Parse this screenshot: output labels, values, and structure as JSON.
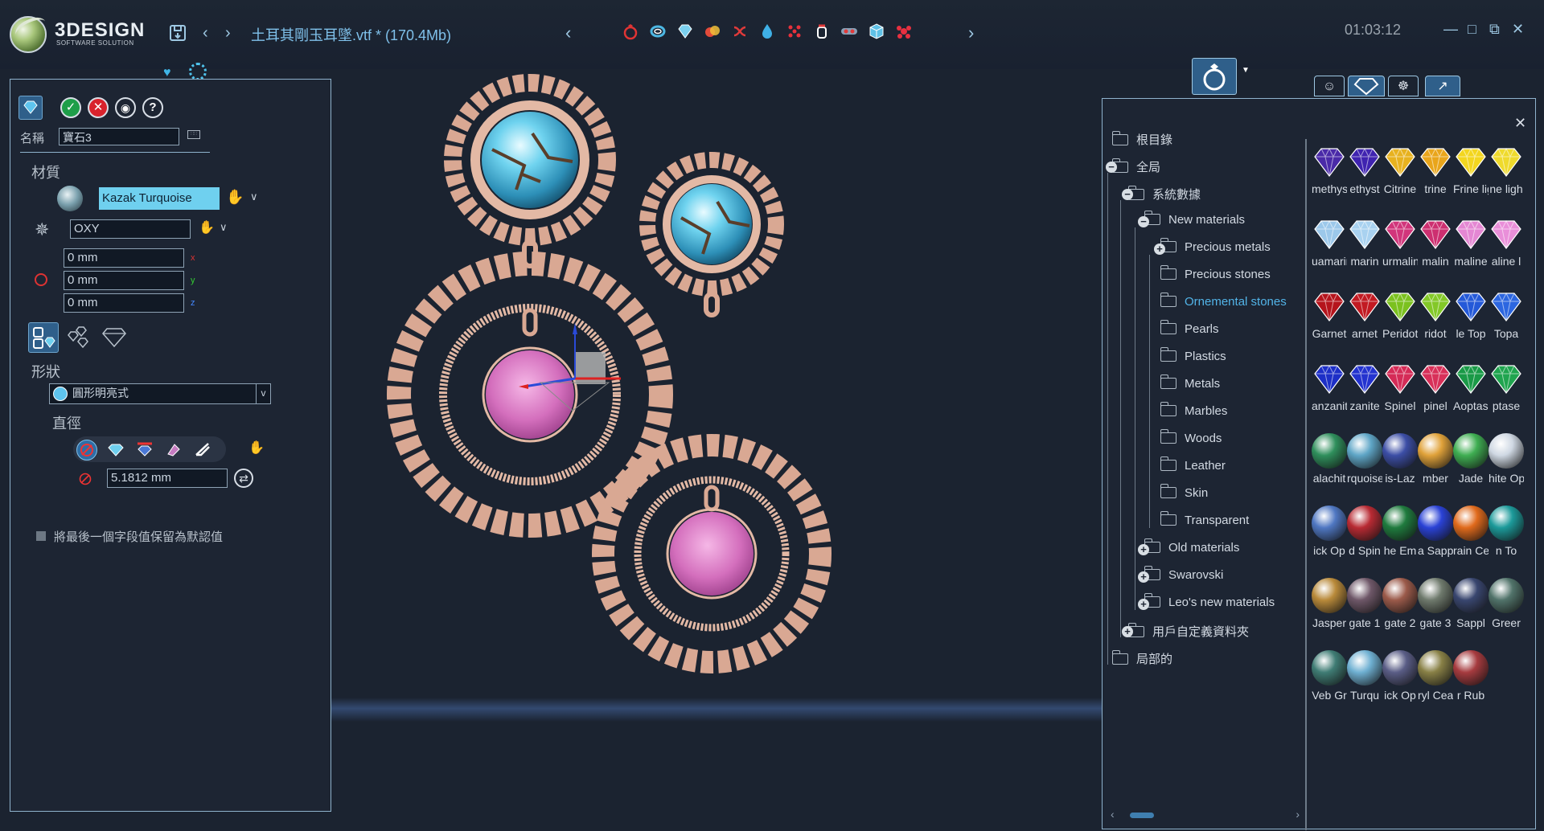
{
  "title_bar": {
    "brand": "3DESIGN",
    "brand_sub": "SOFTWARE SOLUTION",
    "file_title": "土耳其剛玉耳墜.vtf * (170.4Mb)",
    "clock": "01:03:12",
    "toolbar_icons": [
      "ring-icon",
      "bracelet-icon",
      "gem-icon",
      "color-icon",
      "twist-icon",
      "drop-icon",
      "pave-icon",
      "prong-icon",
      "link-icon",
      "cube-icon",
      "cluster-icon"
    ]
  },
  "left_panel": {
    "name_label": "名稱",
    "name_value": "寶石3",
    "material_label": "材質",
    "material_value": "Kazak Turquoise",
    "axis_value": "OXY",
    "position": [
      {
        "value": "0 mm",
        "axis": "x"
      },
      {
        "value": "0 mm",
        "axis": "y"
      },
      {
        "value": "0 mm",
        "axis": "z"
      }
    ],
    "shape_label": "形狀",
    "shape_value": "圓形明亮式",
    "diameter_label": "直徑",
    "diameter_value": "5.1812 mm",
    "keep_default_label": "將最後一個字段值保留為默認值"
  },
  "library": {
    "tree": [
      {
        "label": "根目錄",
        "level": 0,
        "expander": ""
      },
      {
        "label": "全局",
        "level": 0,
        "expander": "−"
      },
      {
        "label": "系統數據",
        "level": 1,
        "expander": "−"
      },
      {
        "label": "New materials",
        "level": 2,
        "expander": "−"
      },
      {
        "label": "Precious metals",
        "level": 3,
        "expander": "+"
      },
      {
        "label": "Precious stones",
        "level": 3,
        "expander": ""
      },
      {
        "label": "Ornemental stones",
        "level": 3,
        "expander": "",
        "active": true
      },
      {
        "label": "Pearls",
        "level": 3,
        "expander": ""
      },
      {
        "label": "Plastics",
        "level": 3,
        "expander": ""
      },
      {
        "label": "Metals",
        "level": 3,
        "expander": ""
      },
      {
        "label": "Marbles",
        "level": 3,
        "expander": ""
      },
      {
        "label": "Woods",
        "level": 3,
        "expander": ""
      },
      {
        "label": "Leather",
        "level": 3,
        "expander": ""
      },
      {
        "label": "Skin",
        "level": 3,
        "expander": ""
      },
      {
        "label": "Transparent",
        "level": 3,
        "expander": ""
      },
      {
        "label": "Old materials",
        "level": 2,
        "expander": "+"
      },
      {
        "label": "Swarovski",
        "level": 2,
        "expander": "+"
      },
      {
        "label": "Leo's new materials",
        "level": 2,
        "expander": "+"
      },
      {
        "label": "用戶自定義資料夾",
        "level": 1,
        "expander": "+"
      },
      {
        "label": "局部的",
        "level": 0,
        "expander": ""
      }
    ],
    "materials": [
      [
        {
          "name": "methyst",
          "color": "#4a2aa8"
        },
        {
          "name": "ethyst",
          "color": "#3f23b0"
        },
        {
          "name": "Citrine",
          "color": "#e7b21f"
        },
        {
          "name": "trine",
          "color": "#e9a51b"
        },
        {
          "name": "Frine lig",
          "color": "#f3d61f"
        },
        {
          "name": "ne ligh",
          "color": "#efda2c"
        }
      ],
      [
        {
          "name": "uamarin",
          "color": "#9cc8ea"
        },
        {
          "name": "marin",
          "color": "#a9d2f0"
        },
        {
          "name": "urmalin",
          "color": "#d1357b"
        },
        {
          "name": "malin",
          "color": "#cd2f70"
        },
        {
          "name": "maline",
          "color": "#e487d3"
        },
        {
          "name": "aline l",
          "color": "#e98fd9"
        }
      ],
      [
        {
          "name": "Garnet",
          "color": "#b5141c"
        },
        {
          "name": "arnet",
          "color": "#c21a22"
        },
        {
          "name": "Peridot",
          "color": "#7bc11f"
        },
        {
          "name": "ridot",
          "color": "#83c828"
        },
        {
          "name": "le Top",
          "color": "#2459d8"
        },
        {
          "name": "Topa",
          "color": "#2c66e0"
        }
      ],
      [
        {
          "name": "anzanite",
          "color": "#1d2fc7"
        },
        {
          "name": "zanite",
          "color": "#2433cf"
        },
        {
          "name": "Spinel",
          "color": "#d52b57"
        },
        {
          "name": "pinel",
          "color": "#d83059"
        },
        {
          "name": "Aoptase",
          "color": "#1a9a47"
        },
        {
          "name": "ptase",
          "color": "#20a44f"
        }
      ],
      [
        {
          "name": "alachit",
          "color": "#2f8f5c"
        },
        {
          "name": "rquoise",
          "color": "#5fa6c7"
        },
        {
          "name": "is-Laz",
          "color": "#3c4ea6"
        },
        {
          "name": "mber",
          "color": "#e0a23a"
        },
        {
          "name": "Jade",
          "color": "#3fae52"
        },
        {
          "name": "hite Op",
          "color": "#cfd8e3"
        }
      ],
      [
        {
          "name": "ick Op",
          "color": "#4f77c2"
        },
        {
          "name": "d Spin",
          "color": "#b82a33"
        },
        {
          "name": "he Em",
          "color": "#1f7b3e"
        },
        {
          "name": "a Sapp",
          "color": "#2a42d6"
        },
        {
          "name": "rain Ce",
          "color": "#e06a1c"
        },
        {
          "name": "n To",
          "color": "#1c9a9a"
        }
      ],
      [
        {
          "name": "Jasper",
          "color": "#b98a3a"
        },
        {
          "name": "gate 1",
          "color": "#6e5768"
        },
        {
          "name": "gate 2",
          "color": "#9b5a4a"
        },
        {
          "name": "gate 3",
          "color": "#6f7a6d"
        },
        {
          "name": "Sappl",
          "color": "#39466f"
        },
        {
          "name": "Greer",
          "color": "#51736a"
        }
      ],
      [
        {
          "name": "Veb Gr",
          "color": "#3f7c74"
        },
        {
          "name": "Turqu",
          "color": "#6fb0d2"
        },
        {
          "name": "ick Op",
          "color": "#5a5d86"
        },
        {
          "name": "ryl Cea",
          "color": "#888046"
        },
        {
          "name": "r Rub",
          "color": "#a63b3f"
        }
      ]
    ]
  }
}
